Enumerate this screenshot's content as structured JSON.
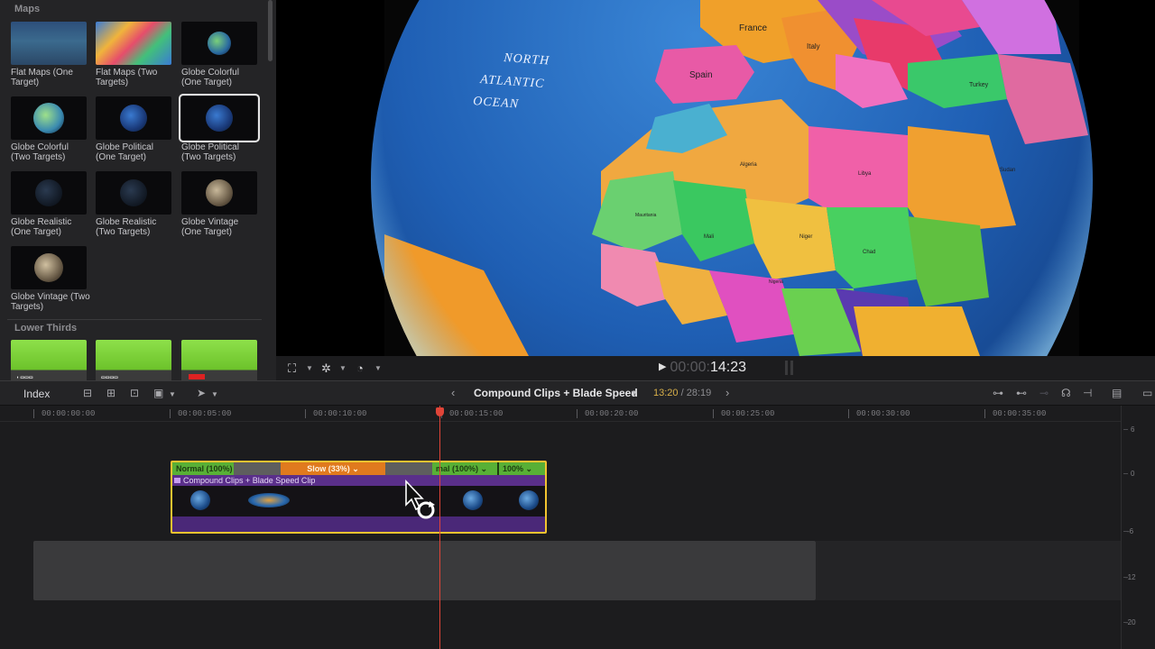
{
  "browser": {
    "categories": [
      {
        "name": "Maps"
      },
      {
        "name": "Lower Thirds"
      }
    ],
    "tiles": [
      {
        "label": "Flat Maps (One Target)"
      },
      {
        "label": "Flat Maps (Two Targets)"
      },
      {
        "label": "Globe Colorful (One Target)"
      },
      {
        "label": "Globe Colorful (Two Targets)"
      },
      {
        "label": "Globe Political (One Target)"
      },
      {
        "label": "Globe Political (Two Targets)"
      },
      {
        "label": "Globe Realistic (One Target)"
      },
      {
        "label": "Globe Realistic (Two Targets)"
      },
      {
        "label": "Globe Vintage (One Target)"
      },
      {
        "label": "Globe Vintage (Two Targets)"
      }
    ]
  },
  "viewer": {
    "ocean_label": [
      "NORTH",
      "ATLANTIC",
      "OCEAN"
    ],
    "countries": {
      "france": "France",
      "spain": "Spain",
      "italy": "Italy",
      "turkey": "Turkey",
      "algeria": "Algeria",
      "libya": "Libya",
      "mali": "Mali",
      "niger": "Niger",
      "chad": "Chad",
      "sudan": "Sudan",
      "mauritania": "Mauritania",
      "nigeria": "Nigeria"
    },
    "timecode_dim": "00:00:",
    "timecode_bright": "14:23"
  },
  "timeline": {
    "index_label": "Index",
    "project_title": "Compound Clips + Blade Speed",
    "duration_current": "13:20",
    "duration_separator": " / ",
    "duration_total": "28:19",
    "ruler": [
      "00:00:00:00",
      "00:00:05:00",
      "00:00:10:00",
      "00:00:15:00",
      "00:00:20:00",
      "00:00:25:00",
      "00:00:30:00",
      "00:00:35:00"
    ],
    "clip": {
      "name": "Compound Clips + Blade Speed Clip",
      "segments": {
        "normal_1": "Normal (100%)",
        "slow": "Slow (33%) ⌄",
        "normal_2": "mal (100%) ⌄",
        "hundred": "100% ⌄"
      }
    }
  },
  "meters": {
    "labels": [
      "6",
      "0",
      "-6",
      "-12",
      "-20"
    ]
  },
  "colors": {
    "clip_border": "#f2c330",
    "speed_normal": "#58b036",
    "speed_slow": "#e07a1e",
    "playhead": "#e04438",
    "compound_purple": "#3d2361"
  }
}
